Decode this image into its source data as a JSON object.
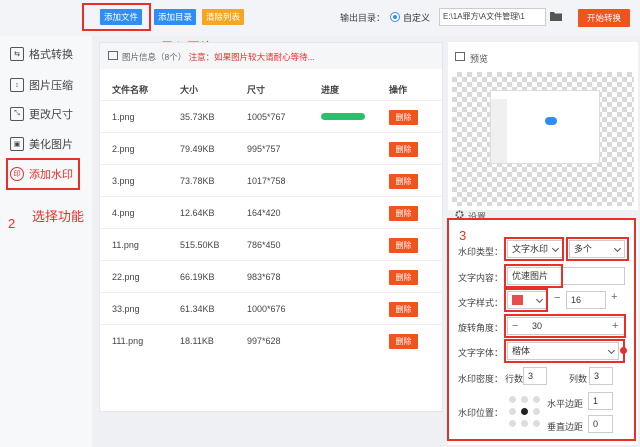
{
  "toolbar": {
    "add_file": "添加文件",
    "add_dir": "添加目录",
    "clear_list": "清除列表",
    "output_label": "输出目录：",
    "custom_label": "自定义",
    "output_path": "E:\\1A罪方\\A文件管理\\1",
    "start": "开始转换"
  },
  "sidebar": {
    "items": [
      {
        "label": "格式转换"
      },
      {
        "label": "图片压缩"
      },
      {
        "label": "更改尺寸"
      },
      {
        "label": "美化图片"
      },
      {
        "label": "添加水印"
      }
    ]
  },
  "annotations": {
    "n1": "1",
    "import": "导入图片",
    "n2": "2",
    "select": "选择功能",
    "n3": "3"
  },
  "file_panel": {
    "title": "图片信息（8个）",
    "notice": "注意：如果图片较大请耐心等待...",
    "headers": {
      "name": "文件名称",
      "size": "大小",
      "dim": "尺寸",
      "progress": "进度",
      "action": "操作"
    },
    "delete_label": "删除",
    "rows": [
      {
        "name": "1.png",
        "size": "35.73KB",
        "dim": "1005*767",
        "progress": 1.0
      },
      {
        "name": "2.png",
        "size": "79.49KB",
        "dim": "995*757",
        "progress": 0
      },
      {
        "name": "3.png",
        "size": "73.78KB",
        "dim": "1017*758",
        "progress": 0
      },
      {
        "name": "4.png",
        "size": "12.64KB",
        "dim": "164*420",
        "progress": 0
      },
      {
        "name": "11.png",
        "size": "515.50KB",
        "dim": "786*450",
        "progress": 0
      },
      {
        "name": "22.png",
        "size": "66.19KB",
        "dim": "983*678",
        "progress": 0
      },
      {
        "name": "33.png",
        "size": "61.34KB",
        "dim": "1000*676",
        "progress": 0
      },
      {
        "name": "111.png",
        "size": "18.11KB",
        "dim": "997*628",
        "progress": 0
      }
    ]
  },
  "preview": {
    "title": "预览"
  },
  "settings": {
    "title": "设置",
    "wm_type_label": "水印类型：",
    "wm_type": "文字水印",
    "wm_count": "多个",
    "text_label": "文字内容：",
    "text_value": "优速图片",
    "style_label": "文字样式：",
    "font_size": "16",
    "rotate_label": "旋转角度：",
    "rotate_value": "30",
    "font_label": "文字字体：",
    "font_value": "楷体",
    "density_label": "水印密度：",
    "rows_label": "行数",
    "rows_value": "3",
    "cols_label": "列数",
    "cols_value": "3",
    "position_label": "水印位置：",
    "h_margin_label": "水平边距",
    "h_margin_value": "1",
    "v_margin_label": "垂直边距",
    "v_margin_value": "0",
    "text_color": "#e84c4c"
  }
}
